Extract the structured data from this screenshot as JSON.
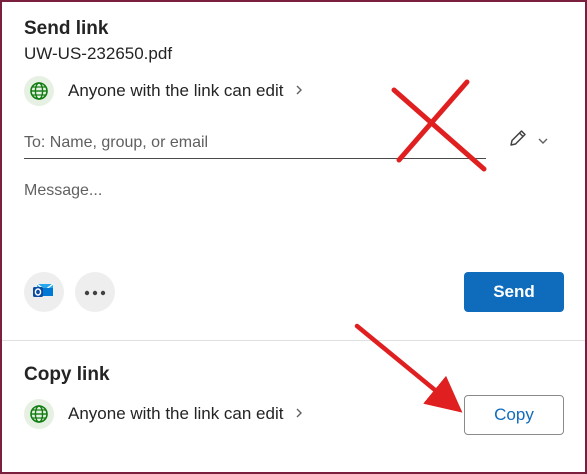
{
  "send_link": {
    "title": "Send link",
    "file_name": "UW-US-232650.pdf",
    "permission": "Anyone with the link can edit",
    "to_placeholder": "To: Name, group, or email",
    "message_placeholder": "Message...",
    "send_label": "Send"
  },
  "copy_link": {
    "title": "Copy link",
    "permission": "Anyone with the link can edit",
    "copy_label": "Copy"
  },
  "icons": {
    "globe": "globe-icon",
    "chevron": "chevron-right-icon",
    "pencil": "pencil-icon",
    "dropdown": "chevron-down-icon",
    "outlook": "outlook-icon",
    "more": "more-options-icon"
  },
  "colors": {
    "accent": "#0f6cbd",
    "annotation": "#e02020",
    "frame_border": "#7a1f3d"
  }
}
